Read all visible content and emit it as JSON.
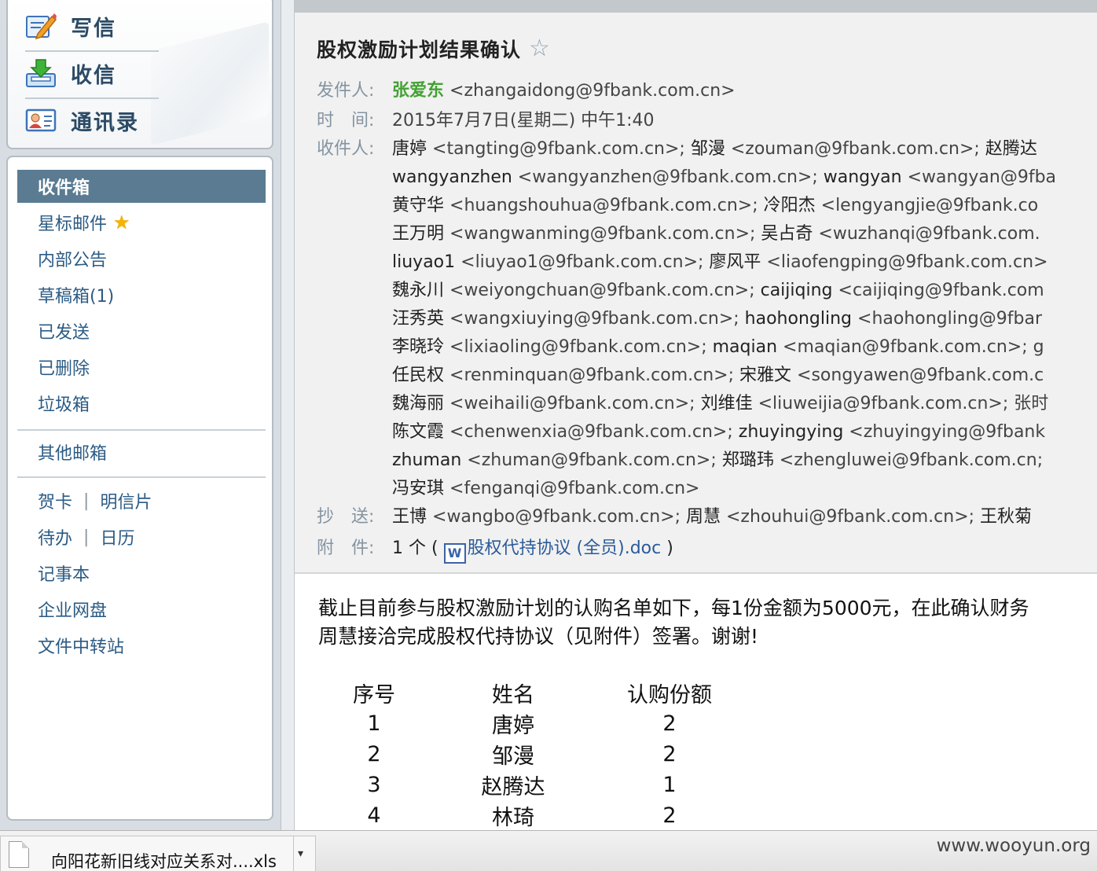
{
  "quick_actions": {
    "compose": "写信",
    "receive": "收信",
    "contacts": "通讯录"
  },
  "folders": {
    "inbox": "收件箱",
    "starred": "星标邮件",
    "announcements": "内部公告",
    "drafts": "草稿箱(1)",
    "sent": "已发送",
    "deleted": "已删除",
    "trash": "垃圾箱",
    "other_mailboxes": "其他邮箱",
    "greeting_card": "贺卡",
    "postcard": "明信片",
    "todo": "待办",
    "calendar": "日历",
    "notepad": "记事本",
    "netdisk": "企业网盘",
    "transfer": "文件中转站",
    "separator": "|"
  },
  "email": {
    "subject": "股权激励计划结果确认",
    "from_label": "发件人:",
    "from_name": "张爱东",
    "from_addr": " <zhangaidong@9fbank.com.cn>",
    "time_label": "时　间:",
    "time": "2015年7月7日(星期二) 中午1:40",
    "to_label": "收件人:",
    "to_lines": [
      [
        {
          "name": "唐婷",
          "addr": " <tangting@9fbank.com.cn>; "
        },
        {
          "name": "邹漫",
          "addr": " <zouman@9fbank.com.cn>; "
        },
        {
          "name": "赵腾达",
          "addr": ""
        }
      ],
      [
        {
          "name": "wangyanzhen",
          "addr": " <wangyanzhen@9fbank.com.cn>; "
        },
        {
          "name": "wangyan",
          "addr": " <wangyan@9fba"
        }
      ],
      [
        {
          "name": "黄守华",
          "addr": " <huangshouhua@9fbank.com.cn>; "
        },
        {
          "name": "冷阳杰",
          "addr": " <lengyangjie@9fbank.co"
        }
      ],
      [
        {
          "name": "王万明",
          "addr": " <wangwanming@9fbank.com.cn>; "
        },
        {
          "name": "吴占奇",
          "addr": " <wuzhanqi@9fbank.com."
        }
      ],
      [
        {
          "name": "liuyao1",
          "addr": " <liuyao1@9fbank.com.cn>; "
        },
        {
          "name": "廖风平",
          "addr": " <liaofengping@9fbank.com.cn>"
        }
      ],
      [
        {
          "name": "魏永川",
          "addr": " <weiyongchuan@9fbank.com.cn>; "
        },
        {
          "name": "caijiqing",
          "addr": " <caijiqing@9fbank.com"
        }
      ],
      [
        {
          "name": "汪秀英",
          "addr": " <wangxiuying@9fbank.com.cn>; "
        },
        {
          "name": "haohongling",
          "addr": " <haohongling@9fbar"
        }
      ],
      [
        {
          "name": "李晓玲",
          "addr": " <lixiaoling@9fbank.com.cn>; "
        },
        {
          "name": "maqian",
          "addr": " <maqian@9fbank.com.cn>; g"
        }
      ],
      [
        {
          "name": "任民权",
          "addr": " <renminquan@9fbank.com.cn>; "
        },
        {
          "name": "宋雅文",
          "addr": " <songyawen@9fbank.com.c"
        }
      ],
      [
        {
          "name": "魏海丽",
          "addr": " <weihaili@9fbank.com.cn>; "
        },
        {
          "name": "刘维佳",
          "addr": " <liuweijia@9fbank.com.cn>; 张时"
        }
      ],
      [
        {
          "name": "陈文霞",
          "addr": " <chenwenxia@9fbank.com.cn>; "
        },
        {
          "name": "zhuyingying",
          "addr": " <zhuyingying@9fbank"
        }
      ],
      [
        {
          "name": "zhuman",
          "addr": " <zhuman@9fbank.com.cn>; "
        },
        {
          "name": "郑璐玮",
          "addr": " <zhengluwei@9fbank.com.cn;"
        }
      ],
      [
        {
          "name": "冯安琪",
          "addr": " <fenganqi@9fbank.com.cn>"
        }
      ]
    ],
    "cc_label": "抄　送:",
    "cc": [
      {
        "name": "王博",
        "addr": " <wangbo@9fbank.com.cn>; "
      },
      {
        "name": "周慧",
        "addr": " <zhouhui@9fbank.com.cn>; "
      },
      {
        "name": "王秋菊",
        "addr": ""
      }
    ],
    "attach_label": "附　件:",
    "attach_count": "1 个 ( ",
    "attach_close": " )",
    "attach_name": "股权代持协议 (全员).doc",
    "body_line1": "截止目前参与股权激励计划的认购名单如下，每1份金额为5000元，在此确认财务",
    "body_line2": "周慧接洽完成股权代持协议（见附件）签署。谢谢!",
    "table": {
      "headers": [
        "序号",
        "姓名",
        "认购份额"
      ],
      "rows": [
        [
          "1",
          "唐婷",
          "2"
        ],
        [
          "2",
          "邹漫",
          "2"
        ],
        [
          "3",
          "赵腾达",
          "1"
        ],
        [
          "4",
          "林琦",
          "2"
        ]
      ]
    }
  },
  "download": {
    "file_name": "向阳花新旧线对应关系对....xls",
    "arrow": "▾"
  },
  "watermark": "www.wooyun.org",
  "icons": {
    "star_outline": "☆",
    "star_filled": "★",
    "doc_letter": "W"
  }
}
